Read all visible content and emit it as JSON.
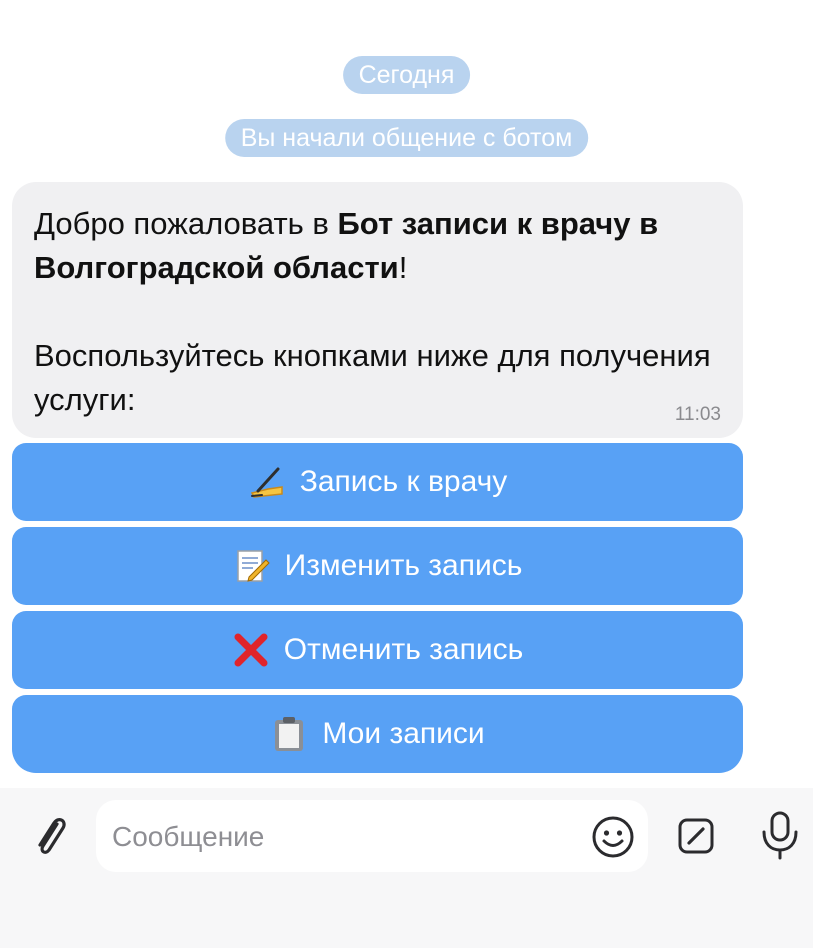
{
  "chat": {
    "date_label": "Сегодня",
    "service_message": "Вы начали общение с ботом"
  },
  "message": {
    "greeting_prefix": "Добро пожаловать в ",
    "bot_name": "Бот записи к врачу в Волгоградской области",
    "greeting_suffix": "!",
    "instruction": "Воспользуйтесь кнопками ниже для получения услуги:",
    "time": "11:03"
  },
  "keyboard": {
    "buttons": [
      {
        "icon": "writing-hand-icon",
        "label": "Запись к врачу"
      },
      {
        "icon": "memo-icon",
        "label": "Изменить запись"
      },
      {
        "icon": "cross-mark-icon",
        "label": "Отменить запись"
      },
      {
        "icon": "clipboard-icon",
        "label": "Мои записи"
      }
    ]
  },
  "composer": {
    "placeholder": "Сообщение",
    "value": ""
  },
  "colors": {
    "accent": "#58a1f5",
    "pill": "#b9d3ef",
    "bubble": "#f0f0f2",
    "icon": "#2b2b2e"
  }
}
